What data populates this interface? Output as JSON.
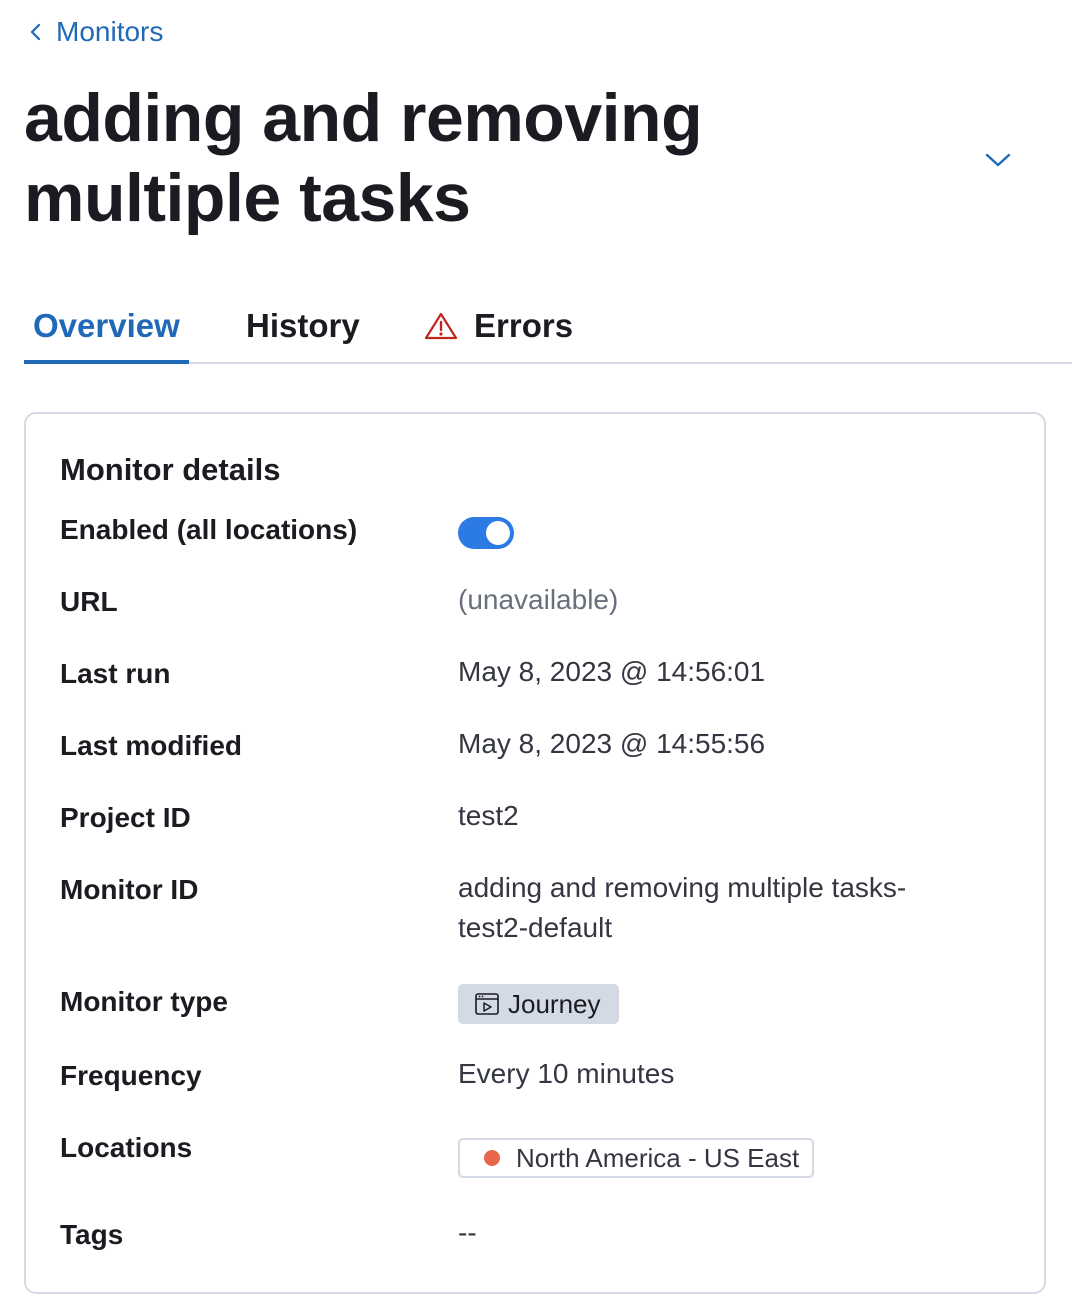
{
  "breadcrumb": {
    "back_label": "Monitors"
  },
  "page": {
    "title": "adding and removing multiple tasks"
  },
  "tabs": [
    {
      "label": "Overview",
      "active": true
    },
    {
      "label": "History",
      "active": false
    },
    {
      "label": "Errors",
      "active": false,
      "icon": "warning-icon"
    }
  ],
  "monitor_details": {
    "heading": "Monitor details",
    "enabled": {
      "label": "Enabled (all locations)",
      "value": true
    },
    "url": {
      "label": "URL",
      "value": "(unavailable)"
    },
    "last_run": {
      "label": "Last run",
      "value": "May 8, 2023 @ 14:56:01"
    },
    "last_modified": {
      "label": "Last modified",
      "value": "May 8, 2023 @ 14:55:56"
    },
    "project_id": {
      "label": "Project ID",
      "value": "test2"
    },
    "monitor_id": {
      "label": "Monitor ID",
      "value_line1": "adding and removing multiple tasks-",
      "value_line2": "test2-default"
    },
    "monitor_type": {
      "label": "Monitor type",
      "value": "Journey",
      "icon": "browser-journey-icon"
    },
    "frequency": {
      "label": "Frequency",
      "value": "Every 10 minutes"
    },
    "locations": {
      "label": "Locations",
      "items": [
        {
          "name": "North America - US East",
          "status_color": "#e7664c"
        }
      ]
    },
    "tags": {
      "label": "Tags",
      "value": "--"
    }
  },
  "colors": {
    "accent": "#1f69b8",
    "toggle_on": "#2c7be5",
    "warning": "#bd271e",
    "location_down": "#e7664c"
  }
}
